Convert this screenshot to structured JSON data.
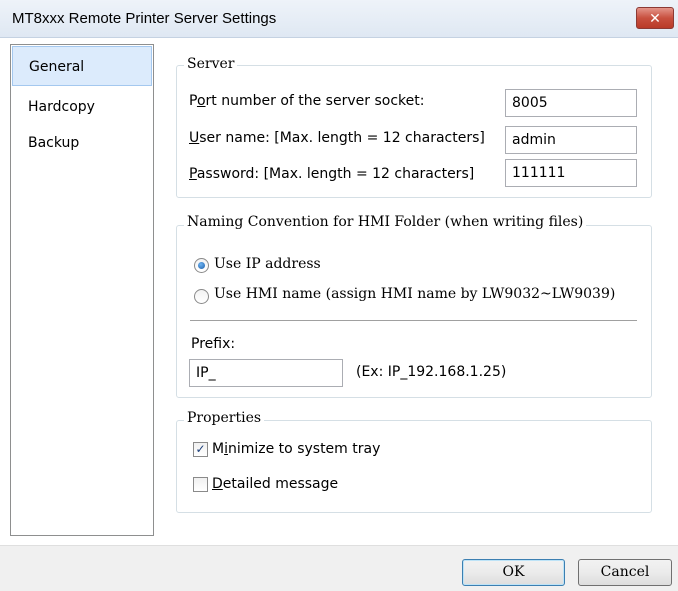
{
  "window": {
    "title": "MT8xxx Remote Printer Server Settings",
    "close_glyph": "✕"
  },
  "nav": {
    "items": [
      {
        "label": "General",
        "active": true
      },
      {
        "label": "Hardcopy",
        "active": false
      },
      {
        "label": "Backup",
        "active": false
      }
    ]
  },
  "server": {
    "title": "Server",
    "port": {
      "label_pre": "P",
      "label_key": "o",
      "label_post": "rt number of the server socket:",
      "value": "8005"
    },
    "user": {
      "label_key": "U",
      "label_post": "ser name: [Max. length = 12 characters]",
      "value": "admin"
    },
    "password": {
      "label_key": "P",
      "label_post": "assword: [Max. length = 12 characters]",
      "value": "111111"
    }
  },
  "naming": {
    "title": "Naming Convention for HMI Folder (when writing files)",
    "option_ip": {
      "label": "Use IP address",
      "selected": true
    },
    "option_hmi": {
      "label": "Use HMI name (assign HMI name by LW9032~LW9039)",
      "selected": false
    },
    "prefix_label": "Prefix:",
    "prefix_value": "IP_",
    "example": "(Ex: IP_192.168.1.25)"
  },
  "properties": {
    "title": "Properties",
    "minimize": {
      "label_pre": "M",
      "label_key": "i",
      "label_post": "nimize to system tray",
      "checked": true
    },
    "detailed": {
      "label_key": "D",
      "label_post": "etailed message",
      "checked": false
    }
  },
  "buttons": {
    "ok": "OK",
    "cancel": "Cancel"
  },
  "icons": {
    "checkmark": "✓"
  }
}
